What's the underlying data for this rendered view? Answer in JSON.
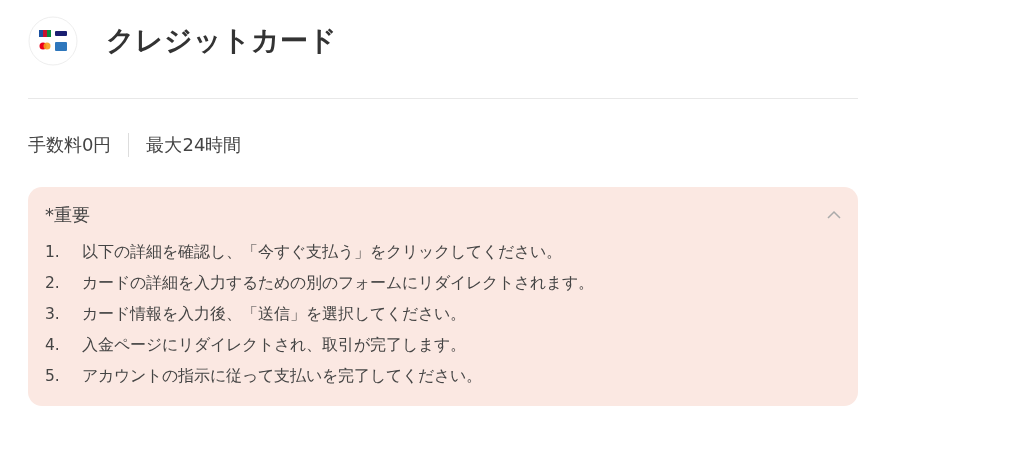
{
  "header": {
    "title": "クレジットカード"
  },
  "info": [
    "手数料0円",
    "最大24時間"
  ],
  "notice": {
    "title": "*重要",
    "expanded": true,
    "steps": [
      {
        "number": "1.",
        "text": "以下の詳細を確認し、「今すぐ支払う」をクリックしてください。"
      },
      {
        "number": "2.",
        "text": "カードの詳細を入力するための別のフォームにリダイレクトされます。"
      },
      {
        "number": "3.",
        "text": "カード情報を入力後、「送信」を選択してください。"
      },
      {
        "number": "4.",
        "text": "入金ページにリダイレクトされ、取引が完了します。"
      },
      {
        "number": "5.",
        "text": "アカウントの指示に従って支払いを完了してください。"
      }
    ]
  }
}
